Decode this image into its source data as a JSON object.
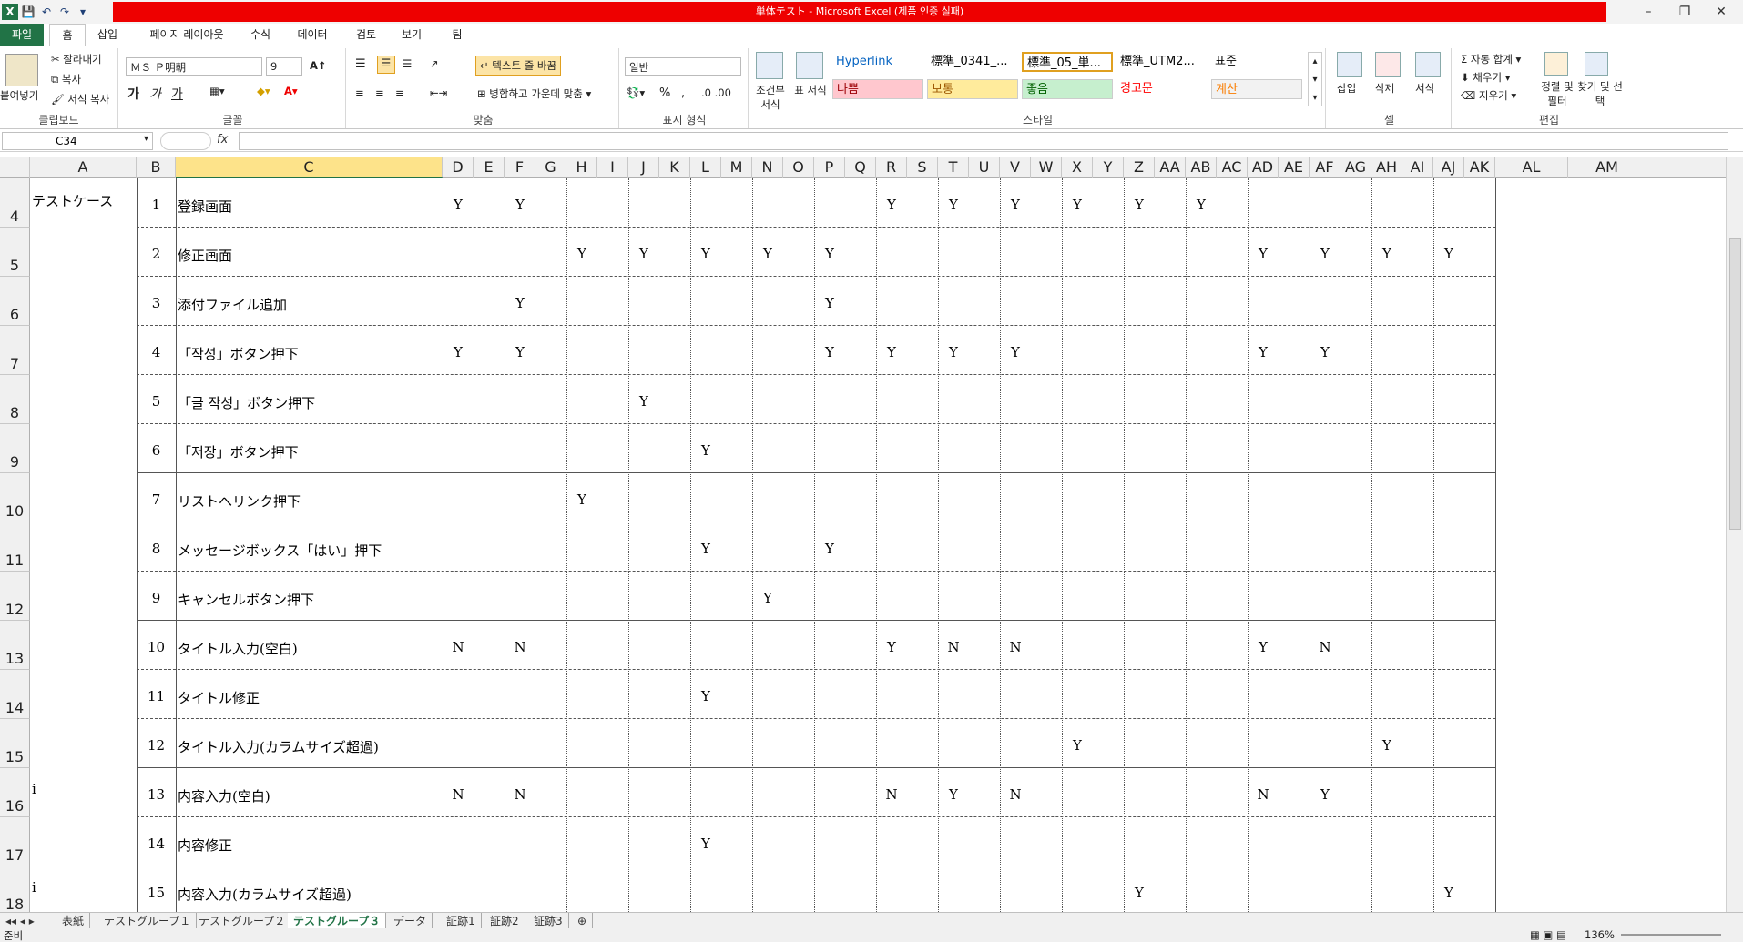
{
  "window": {
    "title": "単体テスト - Microsoft Excel (제품 인증 실패)",
    "min": "–",
    "restore": "❐",
    "close": "✕"
  },
  "ribbon_tabs": [
    "파일",
    "홈",
    "삽입",
    "페이지 레이아웃",
    "수식",
    "데이터",
    "검토",
    "보기",
    "팀"
  ],
  "ribbon": {
    "clipboard": {
      "paste": "붙여넣기",
      "cut": "잘라내기",
      "copy": "복사",
      "format_painter": "서식 복사",
      "label": "클립보드"
    },
    "font": {
      "name": "ＭＳ Ｐ明朝",
      "size": "9",
      "label": "글꼴",
      "bold": "가",
      "italic": "가",
      "underline": "가"
    },
    "align": {
      "wrap": "텍스트 줄 바꿈",
      "merge": "병합하고 가운데 맞춤",
      "label": "맞춤"
    },
    "number": {
      "format": "일반",
      "label": "표시 형식",
      "pct": "%",
      "comma": ","
    },
    "styles": {
      "conditional": "조건부 서식",
      "table": "표 서식",
      "label": "스타일",
      "cells": [
        {
          "text": "Hyperlink",
          "color": "#0563c1",
          "bg": "#ffffff"
        },
        {
          "text": "標準_0341_...",
          "color": "#000000",
          "bg": "#ffffff"
        },
        {
          "text": "標準_05_単...",
          "color": "#000000",
          "bg": "#ffffff"
        },
        {
          "text": "標準_UTM2...",
          "color": "#000000",
          "bg": "#ffffff"
        },
        {
          "text": "표준",
          "color": "#000000",
          "bg": "#ffffff"
        },
        {
          "text": "나쁨",
          "color": "#9c0006",
          "bg": "#ffc7ce"
        },
        {
          "text": "보통",
          "color": "#9c5700",
          "bg": "#ffeb9c"
        },
        {
          "text": "좋음",
          "color": "#006100",
          "bg": "#c6efce"
        },
        {
          "text": "경고문",
          "color": "#ff0000",
          "bg": "#ffffff"
        },
        {
          "text": "계산",
          "color": "#fa7d00",
          "bg": "#f2f2f2"
        }
      ]
    },
    "cells_grp": {
      "insert": "삽입",
      "delete": "삭제",
      "format": "서식",
      "label": "셀"
    },
    "edit": {
      "autosum": "자동 합계",
      "fill": "채우기",
      "clear": "지우기",
      "sort": "정렬 및 필터",
      "find": "찾기 및 선택",
      "label": "편집"
    }
  },
  "formula_bar": {
    "name_box": "C34",
    "fx": "fx",
    "value": ""
  },
  "columns": [
    "A",
    "B",
    "C",
    "D",
    "E",
    "F",
    "G",
    "H",
    "I",
    "J",
    "K",
    "L",
    "M",
    "N",
    "O",
    "P",
    "Q",
    "R",
    "S",
    "T",
    "U",
    "V",
    "W",
    "X",
    "Y",
    "Z",
    "AA",
    "AB",
    "AC",
    "AD",
    "AE",
    "AF",
    "AG",
    "AH",
    "AI",
    "AJ",
    "AK",
    "AL",
    "AM"
  ],
  "selected_column": "C",
  "rows": [
    {
      "num": "4",
      "a": "テストケース",
      "b": "1",
      "c": "登録画面",
      "marks": {
        "D": "Y",
        "F": "Y",
        "R": "Y",
        "T": "Y",
        "V": "Y",
        "X": "Y",
        "Z": "Y",
        "AB": "Y"
      }
    },
    {
      "num": "5",
      "a": "",
      "b": "2",
      "c": "修正画面",
      "marks": {
        "H": "Y",
        "J": "Y",
        "L": "Y",
        "N": "Y",
        "P": "Y",
        "AD": "Y",
        "AF": "Y",
        "AH": "Y",
        "AJ": "Y"
      }
    },
    {
      "num": "6",
      "a": "",
      "b": "3",
      "c": "添付ファイル追加",
      "marks": {
        "F": "Y",
        "P": "Y"
      }
    },
    {
      "num": "7",
      "a": "",
      "b": "4",
      "c": "「작성」ボタン押下",
      "marks": {
        "D": "Y",
        "F": "Y",
        "P": "Y",
        "R": "Y",
        "T": "Y",
        "V": "Y",
        "AD": "Y",
        "AF": "Y"
      }
    },
    {
      "num": "8",
      "a": "",
      "b": "5",
      "c": "「글 작성」ボタン押下",
      "marks": {
        "J": "Y"
      }
    },
    {
      "num": "9",
      "a": "",
      "b": "6",
      "c": "「저장」ボタン押下",
      "marks": {
        "L": "Y"
      }
    },
    {
      "num": "10",
      "a": "",
      "b": "7",
      "c": "リストへリンク押下",
      "marks": {
        "H": "Y"
      }
    },
    {
      "num": "11",
      "a": "",
      "b": "8",
      "c": "メッセージボックス「はい」押下",
      "marks": {
        "L": "Y",
        "P": "Y"
      }
    },
    {
      "num": "12",
      "a": "",
      "b": "9",
      "c": "キャンセルボタン押下",
      "marks": {
        "N": "Y"
      }
    },
    {
      "num": "13",
      "a": "",
      "b": "10",
      "c": "タイトル入力(空白)",
      "marks": {
        "D": "N",
        "F": "N",
        "R": "Y",
        "T": "N",
        "V": "N",
        "AD": "Y",
        "AF": "N"
      }
    },
    {
      "num": "14",
      "a": "",
      "b": "11",
      "c": "タイトル修正",
      "marks": {
        "L": "Y"
      }
    },
    {
      "num": "15",
      "a": "",
      "b": "12",
      "c": "タイトル入力(カラムサイズ超過)",
      "marks": {
        "X": "Y",
        "AH": "Y"
      }
    },
    {
      "num": "16",
      "a": "i",
      "b": "13",
      "c": "内容入力(空白)",
      "marks": {
        "D": "N",
        "F": "N",
        "R": "N",
        "T": "Y",
        "V": "N",
        "AD": "N",
        "AF": "Y"
      }
    },
    {
      "num": "17",
      "a": "",
      "b": "14",
      "c": "内容修正",
      "marks": {
        "L": "Y"
      }
    },
    {
      "num": "18",
      "a": "i",
      "b": "15",
      "c": "内容入力(カラムサイズ超過)",
      "marks": {
        "Z": "Y",
        "AJ": "Y"
      }
    }
  ],
  "sheet_tabs": [
    "表紙",
    "テストグループ１",
    "テストグループ２",
    "テストグループ３",
    "データ",
    "証跡1",
    "証跡2",
    "証跡3"
  ],
  "active_sheet": "テストグループ３",
  "status": {
    "mode": "준비",
    "zoom": "136%"
  }
}
